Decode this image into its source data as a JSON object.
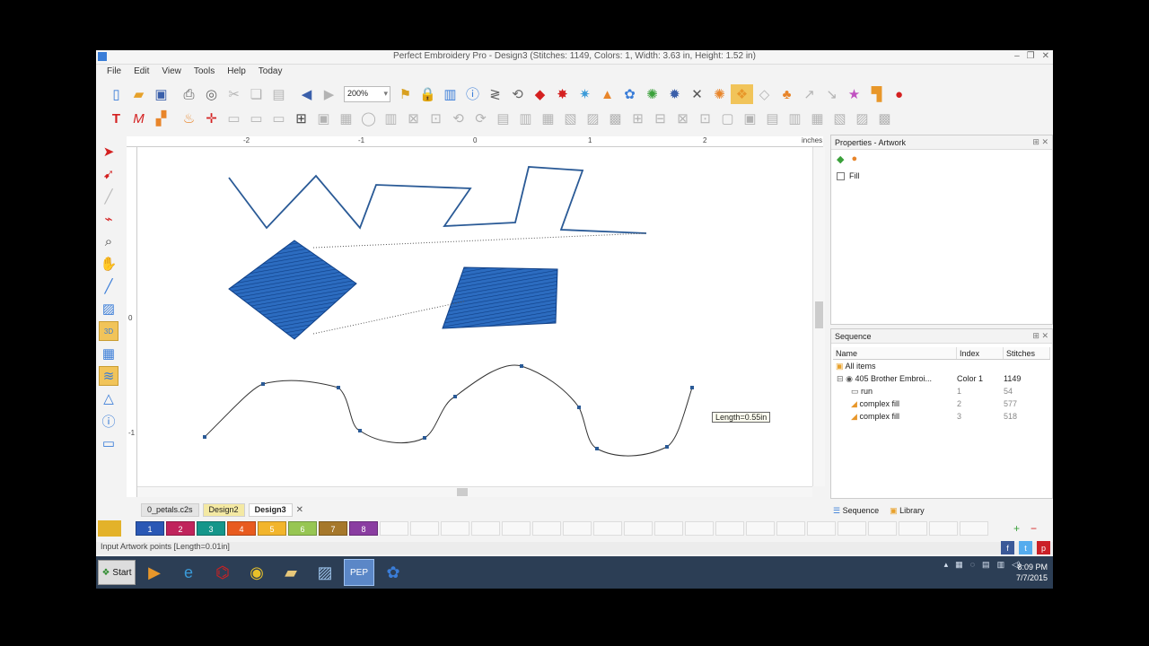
{
  "window": {
    "title": "Perfect Embroidery Pro - Design3 (Stitches: 1149, Colors: 1, Width: 3.63 in, Height: 1.52 in)",
    "controls": [
      "–",
      "❐",
      "✕"
    ]
  },
  "menu": [
    "File",
    "Edit",
    "View",
    "Tools",
    "Help",
    "Today"
  ],
  "toolbar": {
    "zoom": "200%",
    "row1_icons": [
      "new-icon",
      "open-icon",
      "save-icon",
      "print-icon",
      "cut-icon",
      "copy-icon",
      "paste-icon",
      "undo-icon",
      "redo-icon",
      "zoom-icon",
      "lock-icon",
      "grid-icon",
      "info-icon",
      "zigzag-icon",
      "satin-icon",
      "star-icon",
      "fill-icon",
      "color-icon",
      "flower-icon",
      "scissors-icon",
      "sun-icon",
      "group-icon",
      "star-shape-icon",
      "square-icon",
      "help-icon"
    ],
    "row2_icons": [
      "text-icon",
      "monogram-icon",
      "hat-icon",
      "torch-icon",
      "target-icon",
      "disabled-icon",
      "disabled-icon",
      "select-icon",
      "disabled-icon",
      "disabled-icon",
      "disabled-icon",
      "disabled-icon"
    ]
  },
  "left_tools": [
    "pointer-icon",
    "node-edit-icon",
    "knife-icon",
    "stitch-icon",
    "zoom-icon",
    "pan-icon",
    "measure-icon",
    "image-icon",
    "3d-icon",
    "grid-icon",
    "fill-icon",
    "ruler-icon",
    "info-icon",
    "frame-icon"
  ],
  "ruler": {
    "h_labels": [
      "-2",
      "-1",
      "0",
      "1",
      "2"
    ],
    "unit": "inches",
    "v_labels": [
      "0",
      "-1"
    ]
  },
  "tooltip": "Length=0.55in",
  "doc_tabs": [
    "0_petals.c2s",
    "Design2",
    "Design3"
  ],
  "colors": [
    {
      "label": "1",
      "hex": "#2a58b5"
    },
    {
      "label": "2",
      "hex": "#c0245c"
    },
    {
      "label": "3",
      "hex": "#15968a"
    },
    {
      "label": "4",
      "hex": "#e85b1f"
    },
    {
      "label": "5",
      "hex": "#f2b52c"
    },
    {
      "label": "6",
      "hex": "#97c653"
    },
    {
      "label": "7",
      "hex": "#a6782b"
    },
    {
      "label": "8",
      "hex": "#8a3da1"
    }
  ],
  "status": "Input Artwork points [Length=0.01in]",
  "properties": {
    "title": "Properties - Artwork",
    "fill_label": "Fill"
  },
  "sequence": {
    "title": "Sequence",
    "headers": [
      "Name",
      "Index",
      "Stitches"
    ],
    "rows": [
      {
        "name": "All items",
        "index": "",
        "stitches": "",
        "level": 0
      },
      {
        "name": "405 Brother Embroi...",
        "index": "Color 1",
        "stitches": "1149",
        "level": 1
      },
      {
        "name": "run",
        "index": "1",
        "stitches": "54",
        "level": 2
      },
      {
        "name": "complex fill",
        "index": "2",
        "stitches": "577",
        "level": 2
      },
      {
        "name": "complex fill",
        "index": "3",
        "stitches": "518",
        "level": 2
      }
    ],
    "tabs": [
      "Sequence",
      "Library"
    ]
  },
  "taskbar": {
    "start": "Start",
    "apps": [
      "media-icon",
      "ie-icon",
      "acrobat-icon",
      "chrome-icon",
      "folder-icon",
      "photos-icon",
      "pep-icon",
      "flower-icon"
    ],
    "time": "8:09 PM",
    "date": "7/7/2015"
  },
  "social": [
    "f",
    "t",
    "p"
  ]
}
